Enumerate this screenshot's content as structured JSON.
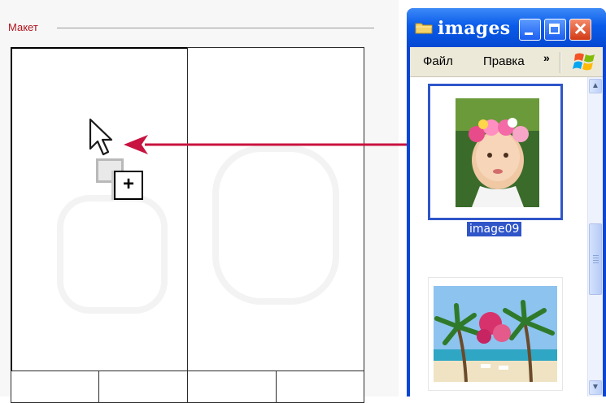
{
  "layout_panel": {
    "title": "Макет"
  },
  "explorer": {
    "title": "images",
    "title_icon": "folder-icon",
    "menu": {
      "file": "Файл",
      "edit": "Правка",
      "more": "»"
    },
    "files": [
      {
        "name": "image09",
        "selected": true,
        "thumbnail": "girl-flower-crown-photo"
      },
      {
        "name": "",
        "selected": false,
        "thumbnail": "tropical-beach-palms-photo"
      }
    ]
  },
  "colors": {
    "layout_title": "#b0141c",
    "drag_arrow": "#c8123f",
    "window_frame": "#0a46d6",
    "selection": "#2f55c9"
  },
  "icons": {
    "minimize": "minimize-icon",
    "maximize": "maximize-icon",
    "close": "close-icon",
    "windows_logo": "windows-logo",
    "cursor": "cursor-arrow-icon",
    "drag_copy": "drag-copy-plus-icon"
  }
}
